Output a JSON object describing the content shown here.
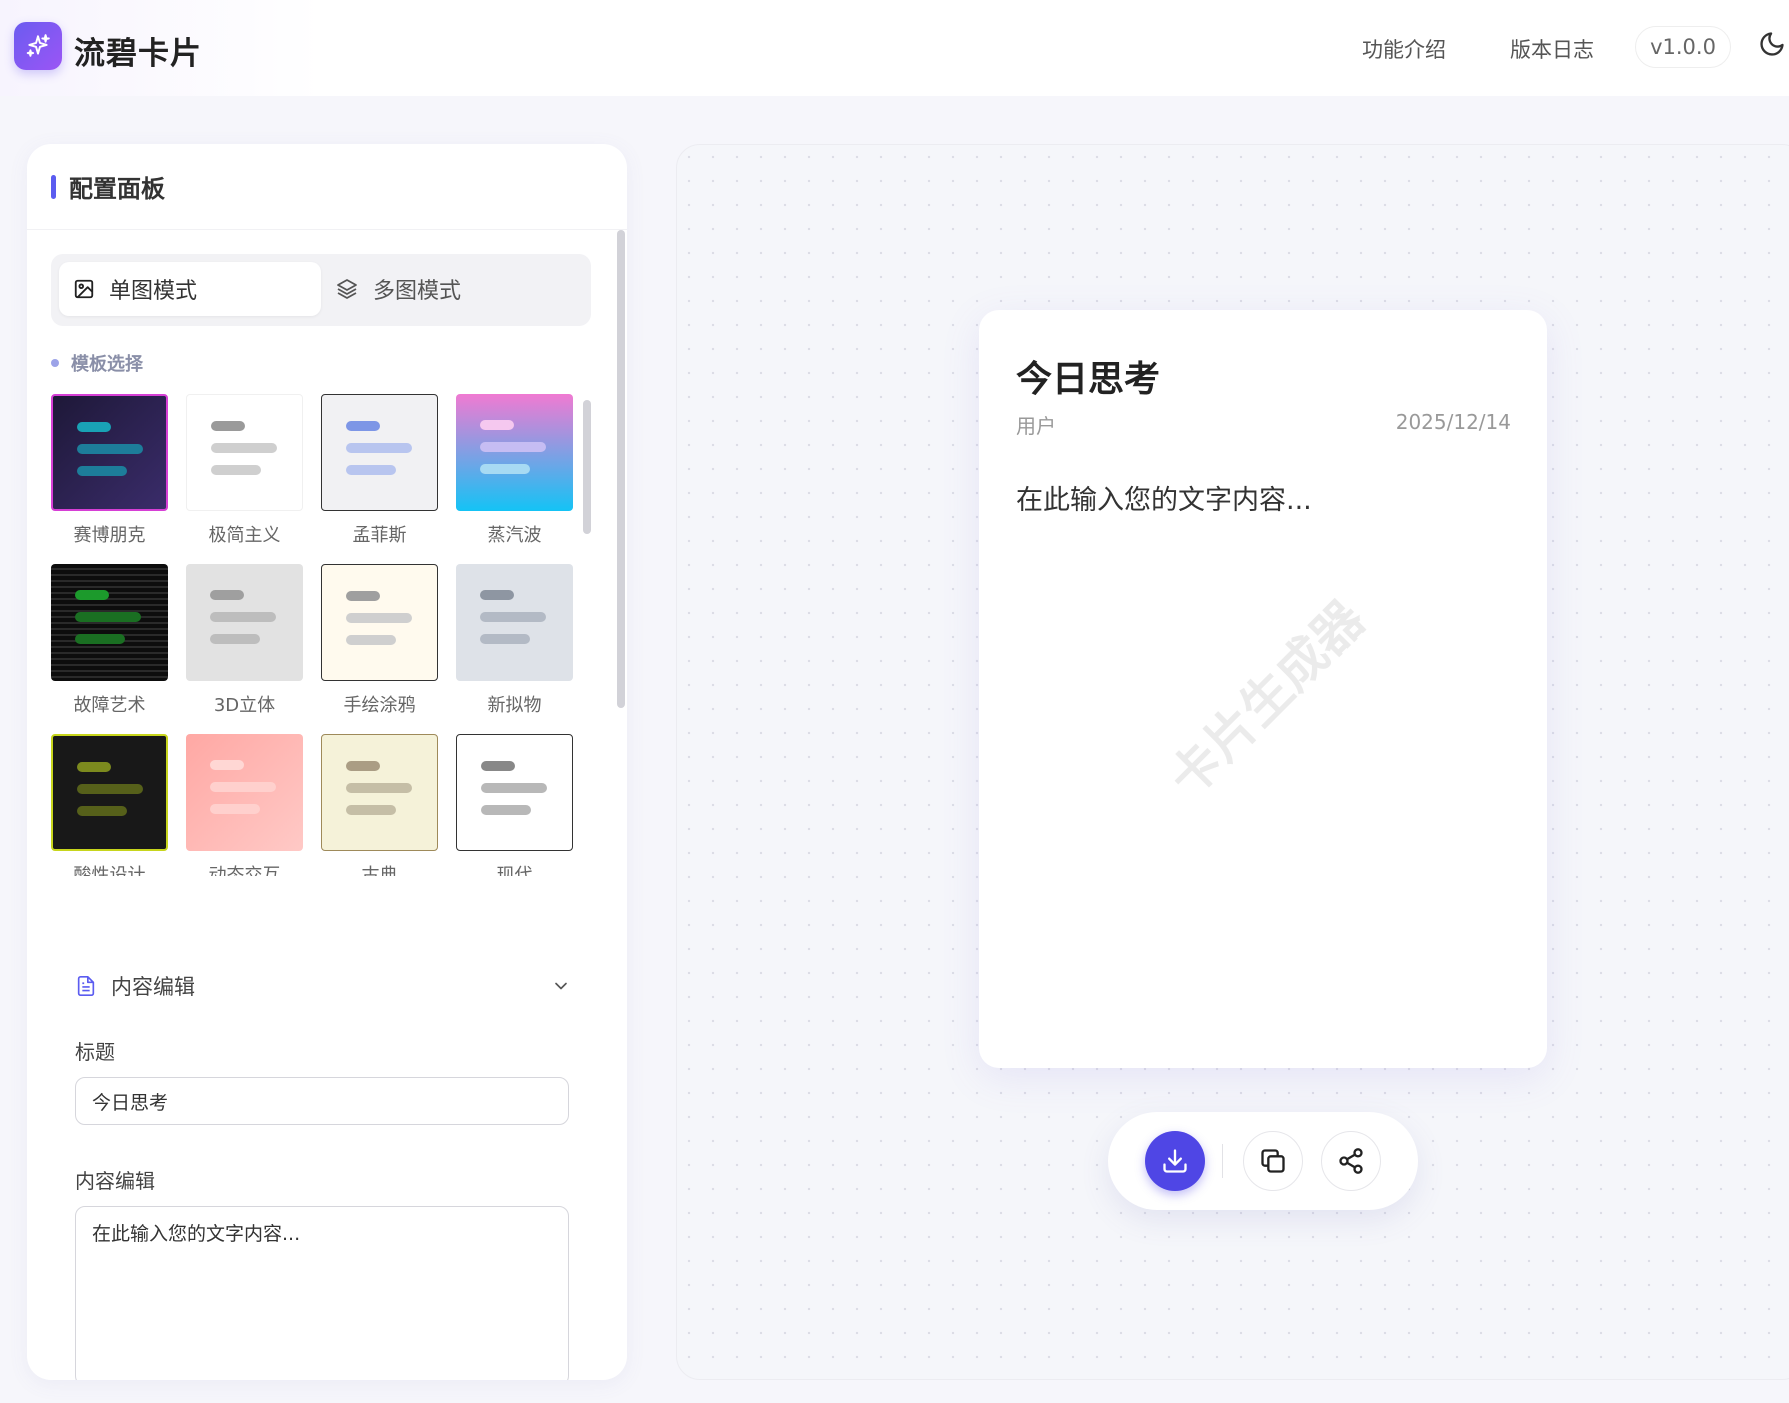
{
  "app": {
    "brand": "流碧卡片",
    "nav": [
      "功能介绍",
      "版本日志"
    ],
    "version": "v1.0.0"
  },
  "panel": {
    "title": "配置面板",
    "modes": [
      {
        "label": "单图模式",
        "active": true
      },
      {
        "label": "多图模式",
        "active": false
      }
    ],
    "template_section_label": "模板选择",
    "templates": [
      {
        "name": "赛博朋克",
        "bg": "#2a1f4f",
        "line": "#19a2b5",
        "border": "#d63fd5"
      },
      {
        "name": "极简主义",
        "bg": "#ffffff",
        "line": "#a3a3a3",
        "border": "#f2f2f2"
      },
      {
        "name": "孟菲斯",
        "bg": "#f1f1f3",
        "line": "#7d96e6",
        "border": "#333333"
      },
      {
        "name": "蒸汽波",
        "bg": "#e97ad8",
        "line": "#f2c7ee",
        "border": "#e97ad8"
      },
      {
        "name": "故障艺术",
        "bg": "#111111",
        "line": "#1a8f2a",
        "border": "#111111"
      },
      {
        "name": "3D立体",
        "bg": "#e2e2e2",
        "line": "#a0a0a0",
        "border": "#e2e2e2"
      },
      {
        "name": "手绘涂鸦",
        "bg": "#fffaee",
        "line": "#a7a7a7",
        "border": "#333333"
      },
      {
        "name": "新拟物",
        "bg": "#dee2e8",
        "line": "#9098a4",
        "border": "#dee2e8"
      },
      {
        "name": "酸性设计",
        "bg": "#181818",
        "line": "#7c8a1e",
        "border": "#c7d51c"
      },
      {
        "name": "动态交互",
        "bg": "#ffb4b0",
        "line": "#ffd3d0",
        "border": "#ffb4b0"
      },
      {
        "name": "古典",
        "bg": "#f5f2d9",
        "line": "#b7ac92",
        "border": "#9e8a5a"
      },
      {
        "name": "现代",
        "bg": "#ffffff",
        "line": "#8a8a8a",
        "border": "#333333"
      }
    ],
    "content_section": {
      "title": "内容编辑",
      "title_label": "标题",
      "title_value": "今日思考",
      "body_label": "内容编辑",
      "body_value": "在此输入您的文字内容..."
    }
  },
  "card": {
    "title": "今日思考",
    "author": "用户",
    "date": "2025/12/14",
    "body": "在此输入您的文字内容...",
    "watermark": "卡片生成器"
  },
  "colors": {
    "accent": "#4f46e5"
  }
}
